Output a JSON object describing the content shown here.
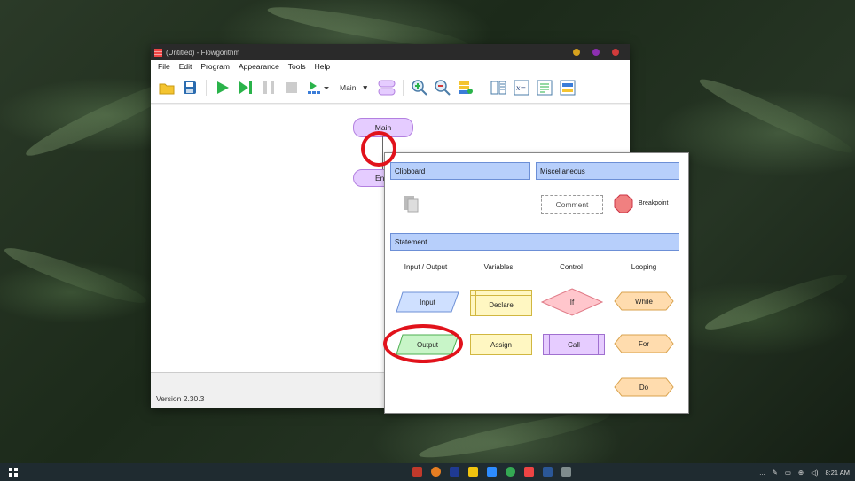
{
  "window": {
    "title": "(Untitled) - Flowgorithm",
    "menu": [
      "File",
      "Edit",
      "Program",
      "Appearance",
      "Tools",
      "Help"
    ],
    "function_select": "Main",
    "status": "Version 2.30.3"
  },
  "canvas": {
    "main_label": "Main",
    "end_label": "En"
  },
  "popup": {
    "clipboard": "Clipboard",
    "misc": "Miscellaneous",
    "comment": "Comment",
    "breakpoint": "Breakpoint",
    "statement": "Statement",
    "col_io": "Input / Output",
    "col_vars": "Variables",
    "col_control": "Control",
    "col_looping": "Looping",
    "input": "Input",
    "output": "Output",
    "declare": "Declare",
    "assign": "Assign",
    "if": "If",
    "call": "Call",
    "while": "While",
    "for": "For",
    "do": "Do"
  },
  "taskbar": {
    "time": "8:21 AM",
    "overflow": "..."
  },
  "colors": {
    "input": "#cfe0ff",
    "output": "#c8f5c8",
    "declare": "#fff7c2",
    "if": "#ffc6cc",
    "call": "#e6ccff",
    "loop": "#ffdcae",
    "section": "#b7cffb",
    "highlight": "#e1121b"
  }
}
